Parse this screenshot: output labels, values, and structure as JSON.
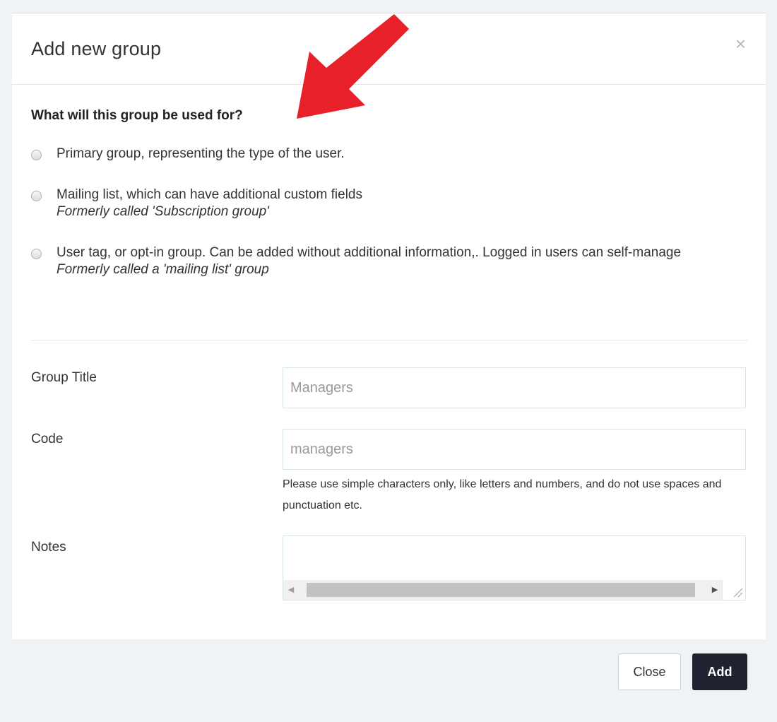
{
  "dialog": {
    "title": "Add new group",
    "close_glyph": "×"
  },
  "usage": {
    "question": "What will this group be used for?",
    "options": [
      {
        "label": "Primary group, representing the type of the user.",
        "note": ""
      },
      {
        "label": "Mailing list, which can have additional custom fields",
        "note": "Formerly called 'Subscription group'"
      },
      {
        "label": "User tag, or opt-in group. Can be added without additional information,. Logged in users can self-manage",
        "note": "Formerly called a 'mailing list' group"
      }
    ]
  },
  "form": {
    "group_title": {
      "label": "Group Title",
      "placeholder": "Managers"
    },
    "code": {
      "label": "Code",
      "placeholder": "managers",
      "help": "Please use simple characters only, like letters and numbers, and do not use spaces and punctuation etc."
    },
    "notes": {
      "label": "Notes",
      "value": ""
    }
  },
  "footer": {
    "close_label": "Close",
    "add_label": "Add"
  },
  "colors": {
    "annotation_arrow": "#e8202a",
    "primary_button": "#1f2330",
    "page_background": "#eff3f6"
  }
}
